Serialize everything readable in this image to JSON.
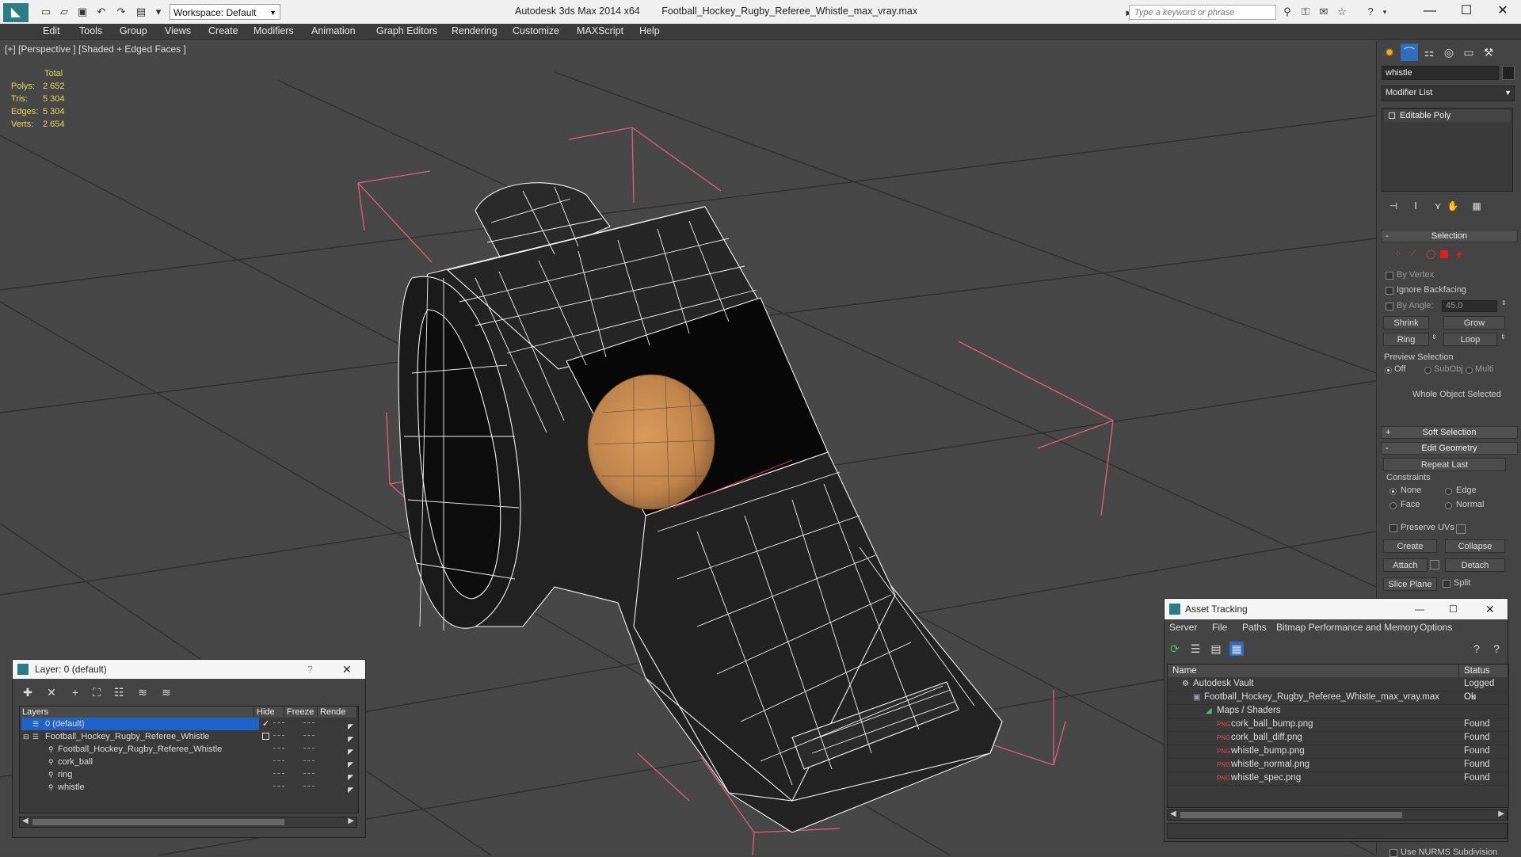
{
  "titlebar": {
    "app_title": "Autodesk 3ds Max  2014 x64",
    "file_title": "Football_Hockey_Rugby_Referee_Whistle_max_vray.max",
    "workspace": "Workspace: Default",
    "search_placeholder": "Type a keyword or phrase"
  },
  "menu": [
    "Edit",
    "Tools",
    "Group",
    "Views",
    "Create",
    "Modifiers",
    "Animation",
    "Graph Editors",
    "Rendering",
    "Customize",
    "MAXScript",
    "Help"
  ],
  "viewport": {
    "label": "[+] [Perspective ] [Shaded + Edged Faces ]",
    "stats": {
      "header": "Total",
      "rows": [
        {
          "label": "Polys:",
          "value": "2 652"
        },
        {
          "label": "Tris:",
          "value": "5 304"
        },
        {
          "label": "Edges:",
          "value": "5 304"
        },
        {
          "label": "Verts:",
          "value": "2 654"
        }
      ]
    }
  },
  "command_panel": {
    "object_name": "whistle",
    "modifier_list": "Modifier List",
    "stack_item": "Editable Poly",
    "selection": {
      "title": "Selection",
      "by_vertex": "By Vertex",
      "ignore_backfacing": "Ignore Backfacing",
      "by_angle": "By Angle:",
      "angle_value": "45.0",
      "shrink": "Shrink",
      "grow": "Grow",
      "ring": "Ring",
      "loop": "Loop",
      "preview_title": "Preview Selection",
      "preview_off": "Off",
      "preview_subobj": "SubObj",
      "preview_multi": "Multi",
      "status": "Whole Object Selected"
    },
    "soft_selection": "Soft Selection",
    "edit_geometry": {
      "title": "Edit Geometry",
      "repeat_last": "Repeat Last",
      "constraints": "Constraints",
      "none": "None",
      "edge": "Edge",
      "face": "Face",
      "normal": "Normal",
      "preserve_uvs": "Preserve UVs",
      "create": "Create",
      "collapse": "Collapse",
      "attach": "Attach",
      "detach": "Detach",
      "slice_plane": "Slice Plane",
      "split": "Split",
      "nurms": "Use NURMS Subdivision"
    }
  },
  "layer_dialog": {
    "title": "Layer: 0 (default)",
    "help": "?",
    "columns": [
      "Layers",
      "Hide",
      "Freeze",
      "Rende"
    ],
    "rows": [
      {
        "name": "0 (default)",
        "indent": 1
      },
      {
        "name": "Football_Hockey_Rugby_Referee_Whistle",
        "indent": 1
      },
      {
        "name": "Football_Hockey_Rugby_Referee_Whistle",
        "indent": 2
      },
      {
        "name": "cork_ball",
        "indent": 2
      },
      {
        "name": "ring",
        "indent": 2
      },
      {
        "name": "whistle",
        "indent": 2
      }
    ]
  },
  "asset_dialog": {
    "title": "Asset Tracking",
    "menu": [
      "Server",
      "File",
      "Paths",
      "Bitmap Performance and Memory",
      "Options"
    ],
    "columns": [
      "Name",
      "Status"
    ],
    "rows": [
      {
        "name": "Autodesk Vault",
        "status": "Logged Ou",
        "level": 1,
        "icon": "vault-icon"
      },
      {
        "name": "Football_Hockey_Rugby_Referee_Whistle_max_vray.max",
        "status": "Ok",
        "level": 2,
        "icon": "max-file-icon"
      },
      {
        "name": "Maps / Shaders",
        "status": "",
        "level": 3,
        "icon": "maps-icon"
      },
      {
        "name": "cork_ball_bump.png",
        "status": "Found",
        "level": 4,
        "icon": "png-icon"
      },
      {
        "name": "cork_ball_diff.png",
        "status": "Found",
        "level": 4,
        "icon": "png-icon"
      },
      {
        "name": "whistle_bump.png",
        "status": "Found",
        "level": 4,
        "icon": "png-icon"
      },
      {
        "name": "whistle_normal.png",
        "status": "Found",
        "level": 4,
        "icon": "png-icon"
      },
      {
        "name": "whistle_spec.png",
        "status": "Found",
        "level": 4,
        "icon": "png-icon"
      }
    ]
  },
  "colors": {
    "viewport_bg": "#474747",
    "selection_blue": "#1f62c8",
    "stats_yellow": "#e6d65a",
    "bbox_pink": "#e0607a",
    "cork": "#c58a4e"
  }
}
